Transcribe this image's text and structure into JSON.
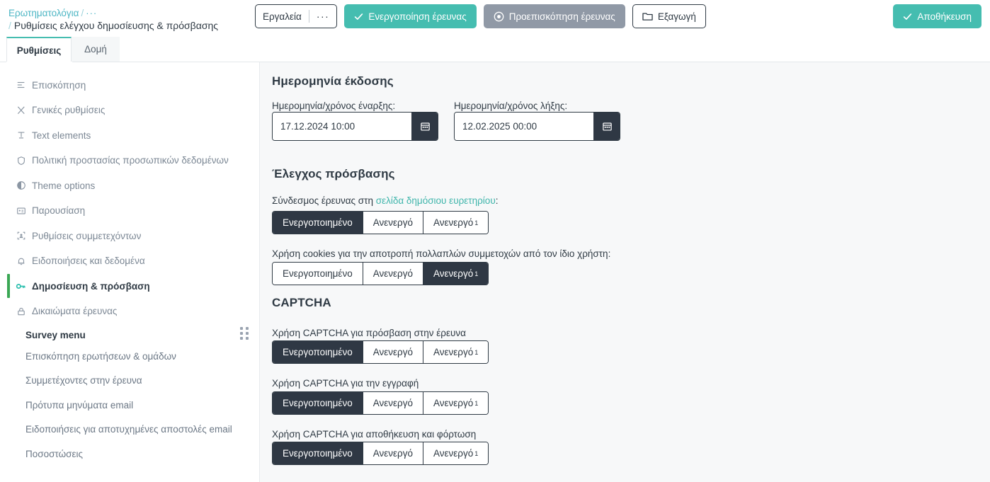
{
  "header": {
    "breadcrumb": {
      "root_label": "Ερωτηματολόγια",
      "separator": "/",
      "ellipsis": "···",
      "current_label": "Ρυθμίσεις ελέγχου δημοσίευσης & πρόσβασης"
    },
    "actions": {
      "tools_label": "Εργαλεία",
      "tools_overflow": "···",
      "activate_label": "Ενεργοποίηση έρευνας",
      "preview_label": "Προεπισκόπηση έρευνας",
      "export_label": "Εξαγωγή",
      "save_label": "Αποθήκευση"
    }
  },
  "tabs": [
    {
      "label": "Ρυθμίσεις",
      "active": true
    },
    {
      "label": "Δομή",
      "active": false
    }
  ],
  "sidebar": {
    "items": [
      {
        "label": "Επισκόπηση",
        "icon": "list-overview-icon",
        "active": false
      },
      {
        "label": "Γενικές ρυθμίσεις",
        "icon": "wrench-icon",
        "active": false
      },
      {
        "label": "Text elements",
        "icon": "text-icon",
        "active": false
      },
      {
        "label": "Πολιτική προστασίας προσωπικών δεδομένων",
        "icon": "shield-icon",
        "active": false
      },
      {
        "label": "Theme options",
        "icon": "contrast-icon",
        "active": false
      },
      {
        "label": "Παρουσίαση",
        "icon": "presentation-icon",
        "active": false
      },
      {
        "label": "Ρυθμίσεις συμμετεχόντων",
        "icon": "participants-icon",
        "active": false
      },
      {
        "label": "Ειδοποιήσεις και δεδομένα",
        "icon": "bell-icon",
        "active": false
      },
      {
        "label": "Δημοσίευση & πρόσβαση",
        "icon": "key-icon",
        "active": true
      },
      {
        "label": "Δικαιώματα έρευνας",
        "icon": "lock-icon",
        "active": false
      }
    ],
    "survey_menu": {
      "title": "Survey menu",
      "drag_handle": "drag-handle-icon",
      "items": [
        {
          "label": "Επισκόπηση ερωτήσεων & ομάδων"
        },
        {
          "label": "Συμμετέχοντες στην έρευνα"
        },
        {
          "label": "Πρότυπα μηνύματα email"
        },
        {
          "label": "Ειδοποιήσεις για αποτυχημένες αποστολές email"
        },
        {
          "label": "Ποσοστώσεις"
        }
      ]
    }
  },
  "main": {
    "publication": {
      "title": "Ημερομηνία έκδοσης",
      "start": {
        "label": "Ημερομηνία/χρόνος έναρξης:",
        "value": "17.12.2024 10:00",
        "placeholder": "",
        "calendar_icon": "calendar-icon"
      },
      "end": {
        "label": "Ημερομηνία/χρόνος λήξης:",
        "value": "12.02.2025 00:00",
        "placeholder": "",
        "calendar_icon": "calendar-icon"
      }
    },
    "access_control": {
      "title": "Έλεγχος πρόσβασης",
      "public_index": {
        "label_prefix": "Σύνδεσμος έρευνας στη ",
        "link_text": "σελίδα δημόσιου ευρετηρίου",
        "label_suffix": ":",
        "options": [
          "Ενεργοποιημένο",
          "Ανενεργό",
          "Ανενεργό"
        ],
        "option_superscripts": [
          "",
          "",
          "1"
        ],
        "selected_index": 0
      },
      "cookies": {
        "label": "Χρήση cookies για την αποτροπή πολλαπλών συμμετοχών από τον ίδιο χρήστη:",
        "options": [
          "Ενεργοποιημένο",
          "Ανενεργό",
          "Ανενεργό"
        ],
        "option_superscripts": [
          "",
          "",
          "1"
        ],
        "selected_index": 2
      }
    },
    "captcha": {
      "title": "CAPTCHA",
      "rows": [
        {
          "label": "Χρήση CAPTCHA για πρόσβαση στην έρευνα",
          "options": [
            "Ενεργοποιημένο",
            "Ανενεργό",
            "Ανενεργό"
          ],
          "option_superscripts": [
            "",
            "",
            "1"
          ],
          "selected_index": 0
        },
        {
          "label": "Χρήση CAPTCHA για την εγγραφή",
          "options": [
            "Ενεργοποιημένο",
            "Ανενεργό",
            "Ανενεργό"
          ],
          "option_superscripts": [
            "",
            "",
            "1"
          ],
          "selected_index": 0
        },
        {
          "label": "Χρήση CAPTCHA για αποθήκευση και φόρτωση",
          "options": [
            "Ενεργοποιημένο",
            "Ανενεργό",
            "Ανενεργό"
          ],
          "option_superscripts": [
            "",
            "",
            "1"
          ],
          "selected_index": 0
        }
      ]
    }
  },
  "colors": {
    "teal": "#45bdb0",
    "teal_link": "#3fb5ab",
    "dark": "#2f3844",
    "gray_button": "#9099a6",
    "active_marker_green": "#3aa754",
    "panel_bg": "#f7f8f9"
  }
}
